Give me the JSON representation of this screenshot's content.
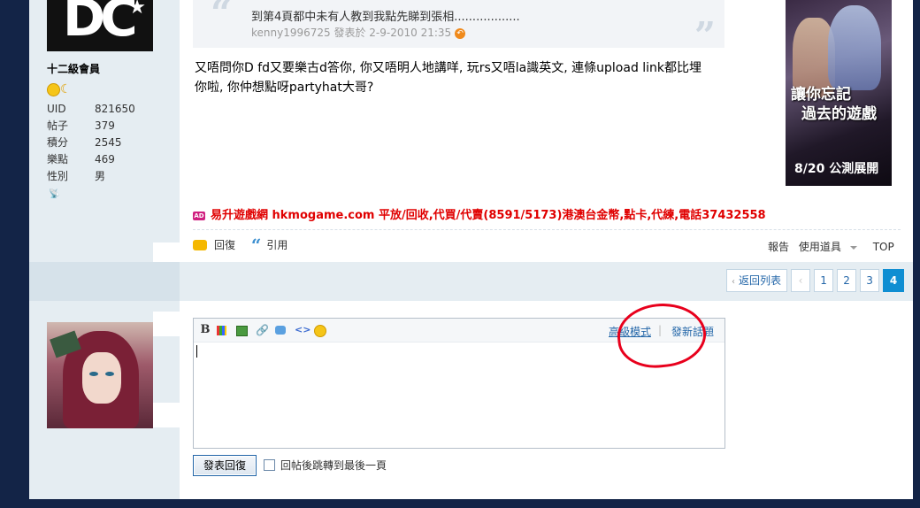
{
  "poster1": {
    "avatar_logo_text": "DC",
    "rank": "十二級會員",
    "stats": [
      {
        "label": "UID",
        "value": "821650"
      },
      {
        "label": "帖子",
        "value": "379"
      },
      {
        "label": "積分",
        "value": "2545"
      },
      {
        "label": "樂點",
        "value": "469"
      },
      {
        "label": "性別",
        "value": "男"
      }
    ]
  },
  "post": {
    "quote_text": "到第4頁都中未有人教到我點先睇到張相..................",
    "quote_meta": "kenny1996725 發表於 2-9-2010 21:35",
    "body": "又唔問你D fd又要樂古d答你, 你又唔明人地講咩, 玩rs又唔la識英文, 連條upload link都比埋你啦, 你仲想點呀partyhat大哥?",
    "promo": "易升遊戲網 hkmogame.com 平放/回收,代買/代賣(8591/5173)港澳台金幣,點卡,代練,電話37432558",
    "ad_line1": "讓你忘記",
    "ad_line2": "過去的遊戲",
    "ad_line3": "8/20 公測展開"
  },
  "actions": {
    "reply": "回復",
    "quote": "引用",
    "report": "報告",
    "tools": "使用道具",
    "top": "TOP"
  },
  "pager": {
    "back": "返回列表",
    "pages": [
      "1",
      "2",
      "3"
    ],
    "current": "4"
  },
  "editor": {
    "bold": "B",
    "advanced": "高級模式",
    "new_topic": "發新話題",
    "submit": "發表回復",
    "jump_label": "回帖後跳轉到最後一頁"
  },
  "colors": {
    "page_bg": "#132447",
    "sidebar_bg": "#e5edf2",
    "link": "#2366a8",
    "promo": "#e00000",
    "pager_active": "#0f8ed2",
    "annotation": "#e8001c"
  }
}
